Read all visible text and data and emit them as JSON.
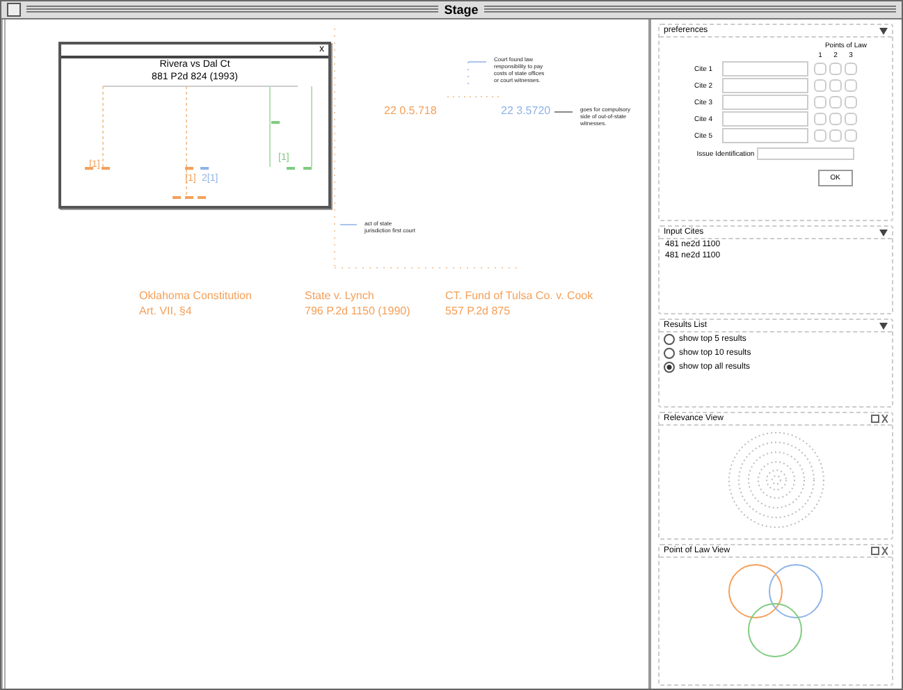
{
  "window": {
    "title": "Stage"
  },
  "popup": {
    "close": "x",
    "title": "Rivera vs Dal Ct",
    "citation": "881 P2d 824 (1993)",
    "labels": [
      {
        "text": "[1]",
        "color": "#f5a05a"
      },
      {
        "text": "[1]",
        "color": "#f5a05a"
      },
      {
        "text": "2[1]",
        "color": "#8fb4e6"
      },
      {
        "text": "[1]",
        "color": "#7fcc7f"
      }
    ]
  },
  "canvas_nodes": [
    {
      "lines": [
        "22 0.5.718"
      ],
      "color": "#f5a05a"
    },
    {
      "lines": [
        "22 3.5720"
      ],
      "color": "#8fb4e6"
    },
    {
      "lines": [
        "Oklahoma Constitution",
        "Art. VII, §4"
      ],
      "color": "#f5a05a"
    },
    {
      "lines": [
        "State v. Lynch",
        "796 P.2d 1150 (1990)"
      ],
      "color": "#f5a05a"
    },
    {
      "lines": [
        "CT. Fund of Tulsa Co. v. Cook",
        "557 P.2d 875"
      ],
      "color": "#f5a05a"
    }
  ],
  "notes": [
    "Court found law responsibility to pay costs of state offices or court witnesses.",
    "goes for compulsory side of out-of-state witnesses.",
    "act of state jurisdiction first court"
  ],
  "input_panel": {
    "title": "preferences",
    "points_header": "Points of Law",
    "point_columns": [
      "1",
      "2",
      "3"
    ],
    "cites": [
      {
        "label": "Cite 1",
        "points": [
          false,
          false,
          false
        ]
      },
      {
        "label": "Cite 2",
        "points": [
          false,
          false,
          false
        ]
      },
      {
        "label": "Cite 3",
        "points": [
          false,
          false,
          false
        ]
      },
      {
        "label": "Cite 4",
        "points": [
          false,
          false,
          false
        ]
      },
      {
        "label": "Cite 5",
        "points": [
          false,
          false,
          false
        ]
      }
    ],
    "issue_label": "Issue Identification",
    "ok": "OK"
  },
  "input_cites": {
    "title": "Input Cites",
    "items": [
      "481 ne2d 1100",
      "481 ne2d 1100"
    ]
  },
  "results_list": {
    "title": "Results List",
    "options": [
      {
        "label": "show top 5 results",
        "selected": false
      },
      {
        "label": "show top 10 results",
        "selected": false
      },
      {
        "label": "show top all results",
        "selected": true
      }
    ]
  },
  "relevance_view": {
    "title": "Relevance View"
  },
  "point_of_law_view": {
    "title": "Point of Law View"
  }
}
